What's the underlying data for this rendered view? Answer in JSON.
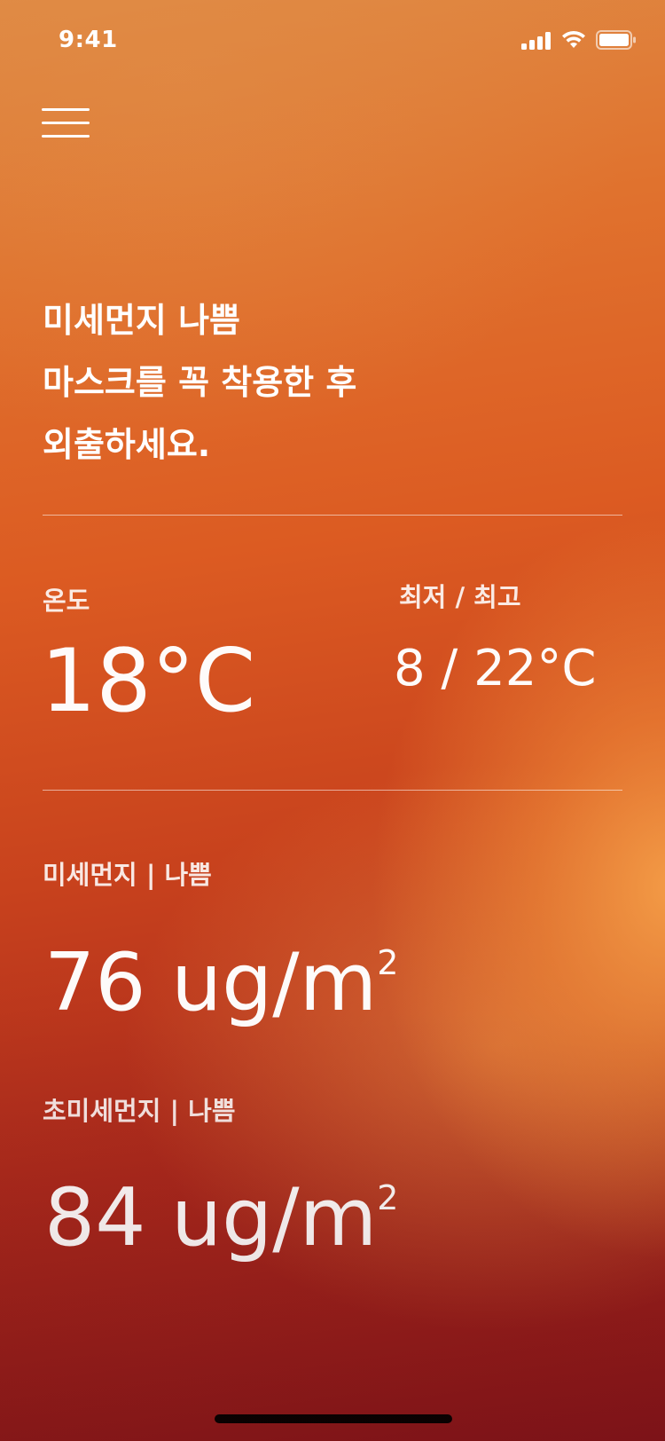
{
  "status_bar": {
    "time": "9:41"
  },
  "menu": {
    "icon": "hamburger-menu-icon"
  },
  "headline": {
    "lines": [
      "미세먼지 나쁨",
      "마스크를 꼭 착용한 후",
      "외출하세요."
    ]
  },
  "temperature": {
    "label": "온도",
    "value": "18°C"
  },
  "temp_range": {
    "label": "최저 / 최고",
    "value": "8 / 22°C"
  },
  "fine_dust": {
    "label": "미세먼지 | 나쁨",
    "value": "76 ug/m",
    "superscript": "2"
  },
  "ultrafine_dust": {
    "label": "초미세먼지 | 나쁨",
    "value": "84 ug/m",
    "superscript": "2"
  },
  "colors": {
    "top": "#df8a44",
    "middle": "#dc5b22",
    "bottom": "#86141a",
    "glow": "#f6a048"
  }
}
